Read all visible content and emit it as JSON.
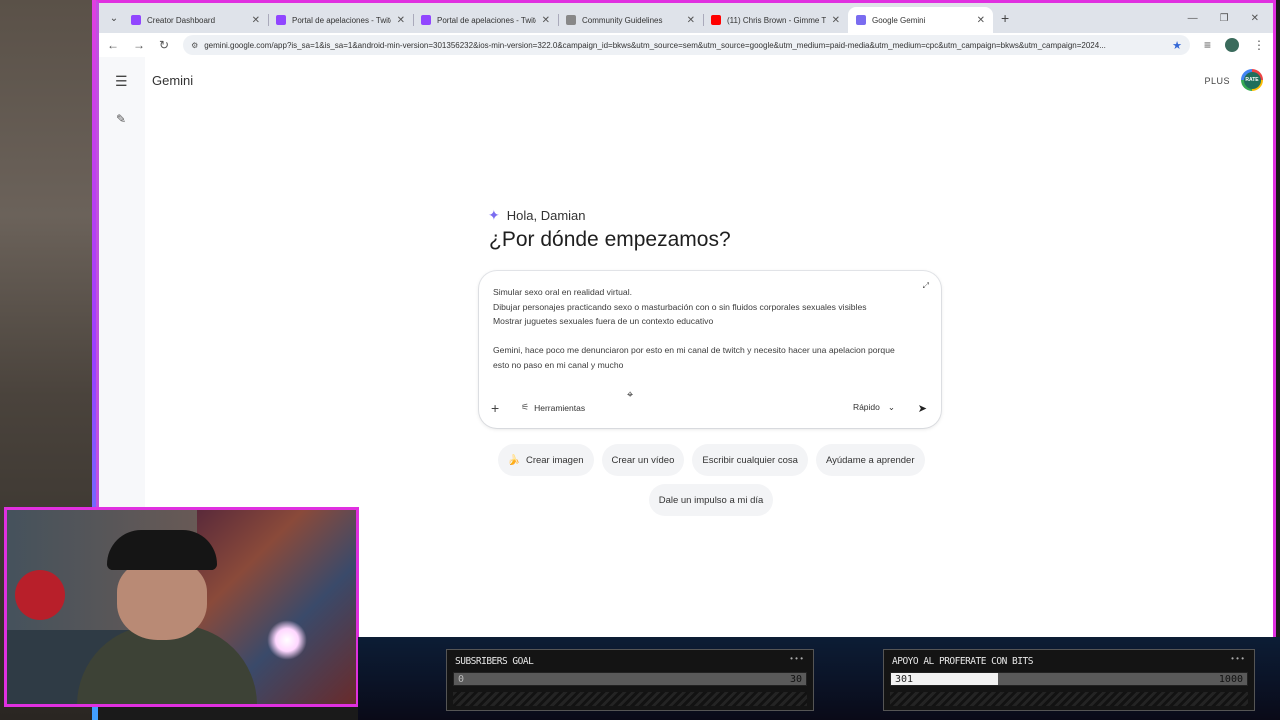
{
  "browser": {
    "tabs": [
      {
        "title": "Creator Dashboard",
        "favicon_color": "#9146ff",
        "active": false
      },
      {
        "title": "Portal de apelaciones - Twitch",
        "favicon_color": "#9146ff",
        "active": false
      },
      {
        "title": "Portal de apelaciones - Twitch",
        "favicon_color": "#9146ff",
        "active": false
      },
      {
        "title": "Community Guidelines",
        "favicon_color": "#888888",
        "active": false
      },
      {
        "title": "(11) Chris Brown - Gimme T",
        "favicon_color": "#ff0000",
        "active": false
      },
      {
        "title": "Google Gemini",
        "favicon_color": "#7a6cf0",
        "active": true
      }
    ],
    "url": "gemini.google.com/app?is_sa=1&is_sa=1&android-min-version=301356232&ios-min-version=322.0&campaign_id=bkws&utm_source=sem&utm_source=google&utm_medium=paid-media&utm_medium=cpc&utm_campaign=bkws&utm_campaign=2024..."
  },
  "app": {
    "title": "Gemini",
    "plan": "PLUS",
    "avatar_text": "RATE",
    "greeting": "Hola, Damian",
    "headline": "¿Por dónde empezamos?",
    "prompt_text": "Simular sexo oral en realidad virtual.\nDibujar personajes practicando sexo o masturbación con o sin fluidos corporales sexuales visibles\nMostrar juguetes sexuales fuera de un contexto educativo\n\nGemini, hace poco me denunciaron por esto en mi canal de twitch y necesito hacer una apelacion porque esto no paso en mi canal y mucho ",
    "tools_label": "Herramientas",
    "speed_label": "Rápido",
    "chips": [
      {
        "label": "Crear imagen",
        "icon": "🍌"
      },
      {
        "label": "Crear un vídeo",
        "icon": ""
      },
      {
        "label": "Escribir cualquier cosa",
        "icon": ""
      },
      {
        "label": "Ayúdame a aprender",
        "icon": ""
      },
      {
        "label": "Dale un impulso a mi día",
        "icon": ""
      }
    ]
  },
  "overlay": {
    "goals": [
      {
        "title": "SUBSRIBERS GOAL",
        "current": "0",
        "max": "30",
        "progress": 0
      },
      {
        "title": "APOYO AL PROFERATE CON BITS",
        "current": "301",
        "max": "1000",
        "progress": 0.301
      }
    ]
  }
}
